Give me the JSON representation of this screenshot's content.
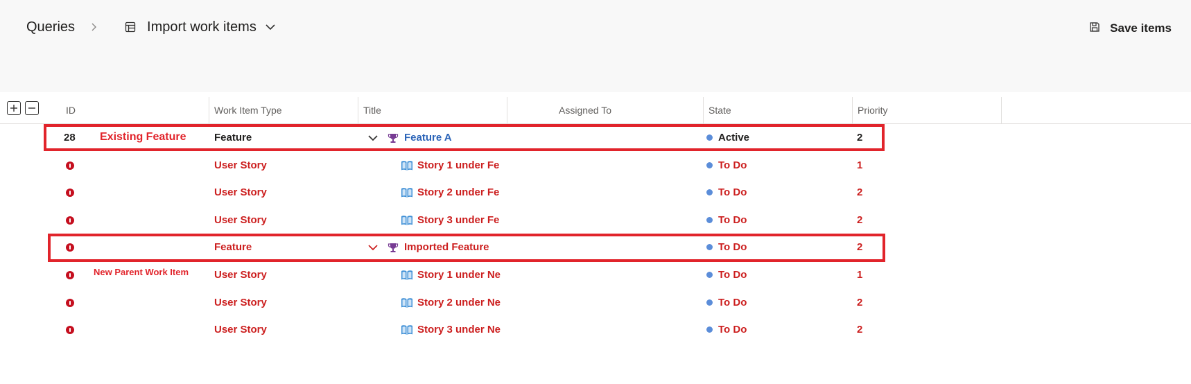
{
  "breadcrumb": {
    "root": "Queries",
    "current": "Import work items"
  },
  "toolbar": {
    "save_label": "Save items"
  },
  "columns": [
    "ID",
    "Work Item Type",
    "Title",
    "Assigned To",
    "State",
    "Priority"
  ],
  "rows": [
    {
      "id": "28",
      "error": false,
      "type": "Feature",
      "title": "Feature A",
      "icon": "trophy-icon",
      "expandable": true,
      "state": "Active",
      "priority": "2",
      "style": "existing"
    },
    {
      "id": "",
      "error": true,
      "type": "User Story",
      "title": "Story 1 under Fe",
      "icon": "book-icon",
      "expandable": false,
      "state": "To Do",
      "priority": "1",
      "style": "new"
    },
    {
      "id": "",
      "error": true,
      "type": "User Story",
      "title": "Story 2 under Fe",
      "icon": "book-icon",
      "expandable": false,
      "state": "To Do",
      "priority": "2",
      "style": "new"
    },
    {
      "id": "",
      "error": true,
      "type": "User Story",
      "title": "Story 3 under Fe",
      "icon": "book-icon",
      "expandable": false,
      "state": "To Do",
      "priority": "2",
      "style": "new"
    },
    {
      "id": "",
      "error": true,
      "type": "Feature",
      "title": "Imported Feature",
      "icon": "trophy-icon",
      "expandable": true,
      "state": "To Do",
      "priority": "2",
      "style": "new"
    },
    {
      "id": "",
      "error": true,
      "type": "User Story",
      "title": "Story 1 under Ne",
      "icon": "book-icon",
      "expandable": false,
      "state": "To Do",
      "priority": "1",
      "style": "new"
    },
    {
      "id": "",
      "error": true,
      "type": "User Story",
      "title": "Story 2 under Ne",
      "icon": "book-icon",
      "expandable": false,
      "state": "To Do",
      "priority": "2",
      "style": "new"
    },
    {
      "id": "",
      "error": true,
      "type": "User Story",
      "title": "Story 3 under Ne",
      "icon": "book-icon",
      "expandable": false,
      "state": "To Do",
      "priority": "2",
      "style": "new"
    }
  ],
  "annotations": {
    "existing_feature": "Existing Feature",
    "new_parent": "New Parent Work Item"
  },
  "colors": {
    "error_red": "#c50f1f",
    "text_red": "#cc1f1f",
    "annotation_red": "#e1242b",
    "state_blue": "#5b8dd9",
    "link_blue": "#2b64b8",
    "trophy_purple": "#773b93",
    "book_blue": "#3e8fd6"
  }
}
